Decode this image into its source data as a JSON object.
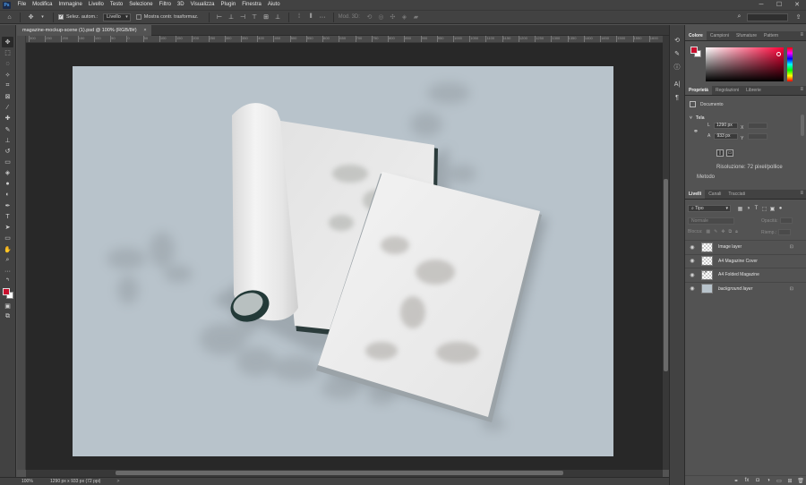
{
  "menubar": {
    "items": [
      "File",
      "Modifica",
      "Immagine",
      "Livello",
      "Testo",
      "Selezione",
      "Filtro",
      "3D",
      "Visualizza",
      "Plugin",
      "Finestra",
      "Aiuto"
    ]
  },
  "options": {
    "auto_select_label": "Selez. autom.:",
    "layer_select": "Livello",
    "transform_label": "Mostra contr. trasformaz.",
    "three_d_label": "Mod. 3D:"
  },
  "document": {
    "tab_title": "magazine-mockup-scene (1).psd @ 100% (RGB/8#)"
  },
  "ruler": {
    "ticks": [
      "300",
      "250",
      "200",
      "150",
      "100",
      "50",
      "0",
      "50",
      "100",
      "150",
      "200",
      "250",
      "300",
      "350",
      "400",
      "450",
      "500",
      "550",
      "600",
      "650",
      "700",
      "750",
      "800",
      "850",
      "900",
      "950",
      "1000",
      "1050",
      "1100",
      "1150",
      "1200",
      "1250",
      "1300",
      "1350",
      "1400",
      "1450",
      "1500",
      "1550",
      "1600"
    ]
  },
  "status": {
    "zoom": "100%",
    "info": "1290 px x 933 px (72 ppi)",
    "arrow": ">"
  },
  "color_panel": {
    "tabs": [
      "Colore",
      "Campioni",
      "Sfumature",
      "Pattern"
    ],
    "fg_color": "#c8102e",
    "bg_color": "#ffffff"
  },
  "properties_panel": {
    "tabs": [
      "Proprietà",
      "Regolazioni",
      "Librerie"
    ],
    "document_label": "Documento",
    "canvas_section": "Tela",
    "width_label": "L",
    "width_value": "1290 px",
    "height_label": "A",
    "height_value": "933 px",
    "x_label": "X",
    "y_label": "Y",
    "resolution": "Risoluzione: 72 pixel/pollice",
    "mode_label": "Metodo"
  },
  "layers_panel": {
    "tabs": [
      "Livelli",
      "Canali",
      "Tracciati"
    ],
    "filter_label": "Tipo",
    "blend_mode": "Normale",
    "opacity_label": "Opacità:",
    "lock_label": "Blocca:",
    "fill_label": "Riemp.:",
    "layers": [
      {
        "name": "Image layer",
        "thumb": "transparent",
        "locked": true,
        "italic": false
      },
      {
        "name": "A4 Magazine Cover",
        "thumb": "transparent",
        "locked": false,
        "italic": false
      },
      {
        "name": "A4 Folded Magazine",
        "thumb": "smart",
        "locked": false,
        "italic": false
      },
      {
        "name": "background layer",
        "thumb": "solid",
        "locked": true,
        "italic": true
      }
    ]
  }
}
